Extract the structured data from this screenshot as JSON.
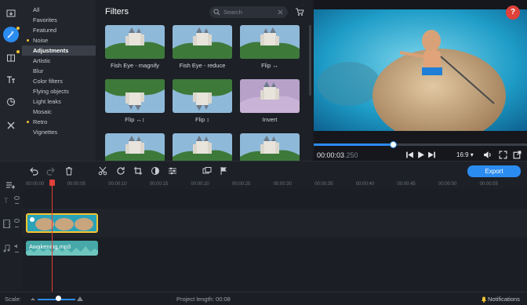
{
  "gallery": {
    "title": "Filters",
    "search_placeholder": "Search",
    "tiles": [
      {
        "label": "Fish Eye - magnify"
      },
      {
        "label": "Fish Eye - reduce"
      },
      {
        "label": "Flip ↔"
      },
      {
        "label": "Flip ↔↕"
      },
      {
        "label": "Flip ↕"
      },
      {
        "label": "Invert"
      },
      {
        "label": ""
      },
      {
        "label": ""
      },
      {
        "label": ""
      }
    ]
  },
  "categories": [
    {
      "label": "All",
      "dot": false
    },
    {
      "label": "Favorites",
      "dot": false
    },
    {
      "label": "Featured",
      "dot": false
    },
    {
      "label": "Noise",
      "dot": true
    },
    {
      "label": "Adjustments",
      "dot": false,
      "selected": true
    },
    {
      "label": "Artistic",
      "dot": false
    },
    {
      "label": "Blur",
      "dot": false
    },
    {
      "label": "Color filters",
      "dot": false
    },
    {
      "label": "Flying objects",
      "dot": false
    },
    {
      "label": "Light leaks",
      "dot": false
    },
    {
      "label": "Mosaic",
      "dot": false
    },
    {
      "label": "Retro",
      "dot": true
    },
    {
      "label": "Vignettes",
      "dot": false
    }
  ],
  "rail_icons": [
    "import-icon",
    "filters-magic-icon",
    "transitions-icon",
    "titles-icon",
    "stickers-icon",
    "more-tools-icon"
  ],
  "preview": {
    "help_label": "?",
    "timecode": "00:00:03",
    "timecode_ms": ".250",
    "playback_progress": 0.37,
    "aspect_ratio": "16:9 ▾"
  },
  "toolbar": {
    "export_label": "Export"
  },
  "timeline": {
    "ruler_ticks": [
      "00:00:00",
      "00:00:05",
      "00:00:10",
      "00:00:15",
      "00:00:20",
      "00:00:25",
      "00:00:30",
      "00:00:35",
      "00:00:40",
      "00:00:45",
      "00:00:50",
      "00:00:55"
    ],
    "audio_clip_name": "Awakening.mp3"
  },
  "status": {
    "scale_label": "Scale:",
    "project_length": "Project length:  00:08",
    "notifications": "Notifications"
  },
  "colors": {
    "accent": "#2b8cf0",
    "playhead": "#e0413a",
    "clip_border": "#f4c430"
  }
}
